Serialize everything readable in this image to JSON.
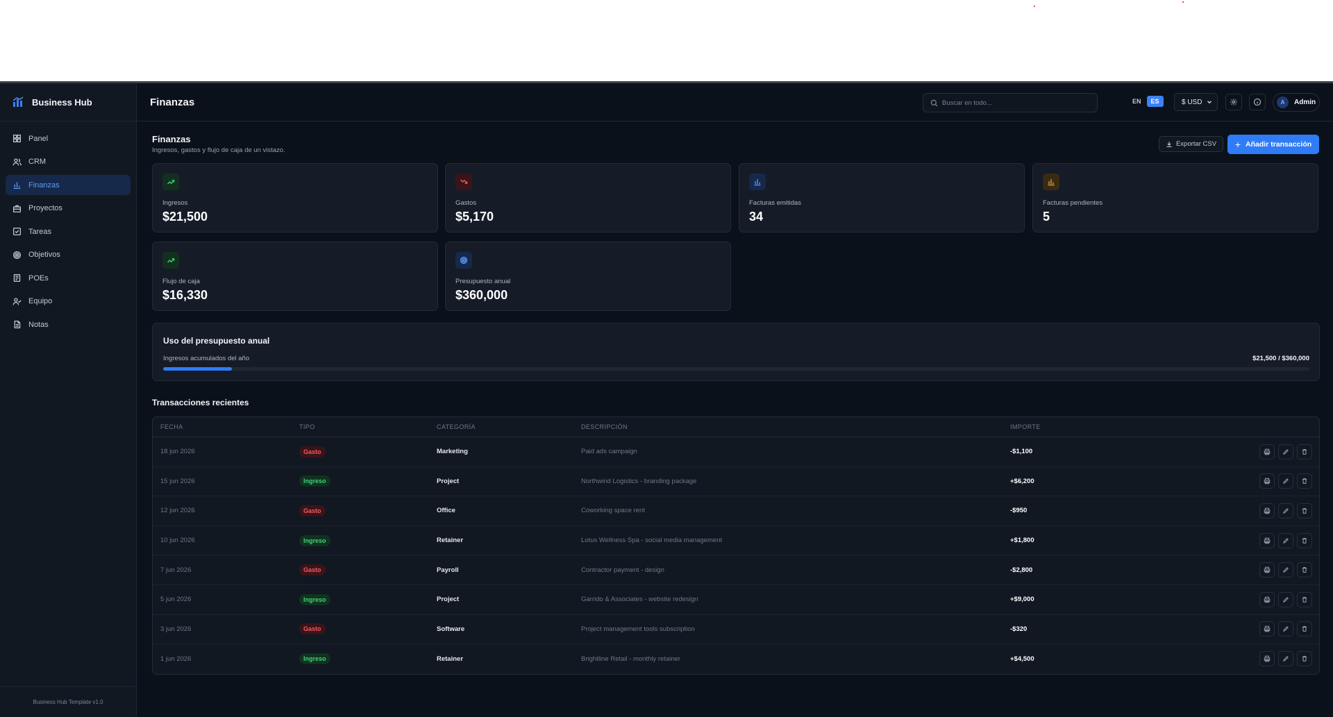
{
  "brand": {
    "name": "Business Hub"
  },
  "sidebar": {
    "items": [
      {
        "label": "Panel",
        "icon": "grid-icon",
        "active": false
      },
      {
        "label": "CRM",
        "icon": "users-icon",
        "active": false
      },
      {
        "label": "Finanzas",
        "icon": "bar-chart-icon",
        "active": true
      },
      {
        "label": "Proyectos",
        "icon": "briefcase-icon",
        "active": false
      },
      {
        "label": "Tareas",
        "icon": "checkbox-icon",
        "active": false
      },
      {
        "label": "Objetivos",
        "icon": "target-icon",
        "active": false
      },
      {
        "label": "POEs",
        "icon": "document-icon",
        "active": false
      },
      {
        "label": "Equipo",
        "icon": "team-icon",
        "active": false
      },
      {
        "label": "Notas",
        "icon": "note-icon",
        "active": false
      }
    ],
    "footer": "Business Hub Template v1.0"
  },
  "header": {
    "title": "Finanzas",
    "search_placeholder": "Buscar en todo...",
    "lang_en": "EN",
    "lang_es": "ES",
    "currency": "$ USD",
    "user": "Admin",
    "user_initial": "A"
  },
  "page": {
    "title": "Finanzas",
    "subtitle": "Ingresos, gastos y flujo de caja de un vistazo.",
    "export_label": "Exportar CSV",
    "add_label": "Añadir transacción"
  },
  "stats": [
    {
      "label": "Ingresos",
      "value": "$21,500",
      "icon": "trending-up-icon",
      "color": "#3ed37a",
      "bg": "#13301f"
    },
    {
      "label": "Gastos",
      "value": "$5,170",
      "icon": "trending-down-icon",
      "color": "#f05b68",
      "bg": "#3a1418"
    },
    {
      "label": "Facturas emitidas",
      "value": "34",
      "icon": "bar-chart-icon",
      "color": "#5c9bff",
      "bg": "#16294a"
    },
    {
      "label": "Facturas pendientes",
      "value": "5",
      "icon": "bar-chart-icon",
      "color": "#f0a23a",
      "bg": "#3a2a12"
    },
    {
      "label": "Flujo de caja",
      "value": "$16,330",
      "icon": "trending-up-icon",
      "color": "#3ed37a",
      "bg": "#13301f"
    },
    {
      "label": "Presupuesto anual",
      "value": "$360,000",
      "icon": "target-icon",
      "color": "#5c9bff",
      "bg": "#16294a"
    }
  ],
  "budget": {
    "title": "Uso del presupuesto anual",
    "label": "Ingresos acumulados del año",
    "value_text": "$21,500 / $360,000",
    "progress_percent": 5.97
  },
  "transactions": {
    "title": "Transacciones recientes",
    "columns": [
      "FECHA",
      "TIPO",
      "CATEGORÍA",
      "DESCRIPCIÓN",
      "IMPORTE"
    ],
    "rows": [
      {
        "date": "18 jun 2026",
        "type": "Gasto",
        "category": "Marketing",
        "description": "Paid ads campaign",
        "amount": "-$1,100"
      },
      {
        "date": "15 jun 2026",
        "type": "Ingreso",
        "category": "Project",
        "description": "Northwind Logistics - branding package",
        "amount": "+$6,200"
      },
      {
        "date": "12 jun 2026",
        "type": "Gasto",
        "category": "Office",
        "description": "Coworking space rent",
        "amount": "-$950"
      },
      {
        "date": "10 jun 2026",
        "type": "Ingreso",
        "category": "Retainer",
        "description": "Lotus Wellness Spa - social media management",
        "amount": "+$1,800"
      },
      {
        "date": "7 jun 2026",
        "type": "Gasto",
        "category": "Payroll",
        "description": "Contractor payment - design",
        "amount": "-$2,800"
      },
      {
        "date": "5 jun 2026",
        "type": "Ingreso",
        "category": "Project",
        "description": "Garrido & Associates - website redesign",
        "amount": "+$9,000"
      },
      {
        "date": "3 jun 2026",
        "type": "Gasto",
        "category": "Software",
        "description": "Project management tools subscription",
        "amount": "-$320"
      },
      {
        "date": "1 jun 2026",
        "type": "Ingreso",
        "category": "Retainer",
        "description": "Brightline Retail - monthly retainer",
        "amount": "+$4,500"
      }
    ]
  }
}
